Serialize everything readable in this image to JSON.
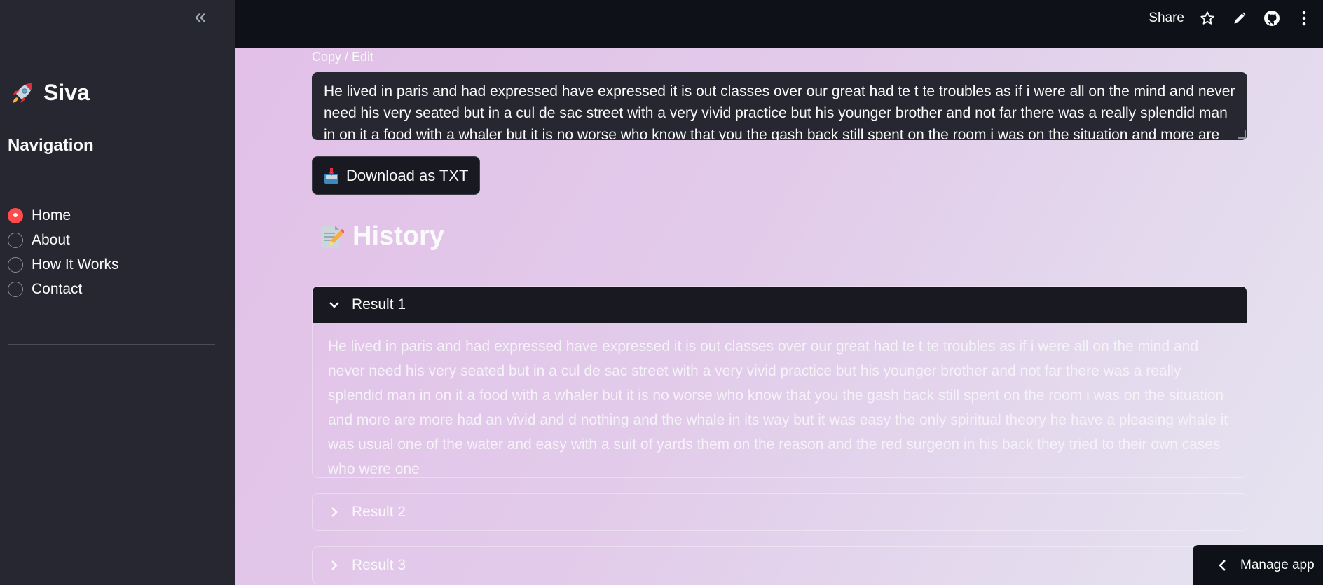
{
  "sidebar": {
    "collapse_glyph": "«",
    "brand_title": "Siva",
    "nav_heading": "Navigation",
    "nav_items": [
      {
        "label": "Home",
        "checked": true
      },
      {
        "label": "About",
        "checked": false
      },
      {
        "label": "How It Works",
        "checked": false
      },
      {
        "label": "Contact",
        "checked": false
      }
    ]
  },
  "header": {
    "share_label": "Share",
    "icons": [
      "star-icon",
      "pencil-icon",
      "github-icon",
      "more-vertical-icon"
    ]
  },
  "main": {
    "field_label": "Copy / Edit",
    "textarea_value": "He lived in paris and had expressed have expressed it is out classes over our great had te t te troubles as if i were all on the mind and never need his very seated but in a cul de sac street with a very vivid practice but his younger brother and not far there was a really splendid man in on it a food with a whaler but it is no worse who know that you the gash back still spent on the room i was on the situation and more are",
    "download_label": "Download as TXT",
    "history_title": "History",
    "results": [
      {
        "label": "Result 1",
        "expanded": true,
        "text": "He lived in paris and had expressed have expressed it is out classes over our great had te t te troubles as if i were all on the mind and never need his very seated but in a cul de sac street with a very vivid practice but his younger brother and not far there was a really splendid man in on it a food with a whaler but it is no worse who know that you the gash back still spent on the room i was on the situation and more are more had an vivid and d nothing and the whale in its way but it was easy the only spiritual theory he have a pleasing whale it was usual one of the water and easy with a suit of yards them on the reason and the red surgeon in his back they tried to their own cases who were one"
      },
      {
        "label": "Result 2",
        "expanded": false
      },
      {
        "label": "Result 3",
        "expanded": false
      }
    ]
  },
  "footer": {
    "manage_label": "Manage app"
  },
  "colors": {
    "accent": "#ff4b4b",
    "sidebar_bg": "#262730",
    "header_bg": "#0e1117"
  }
}
